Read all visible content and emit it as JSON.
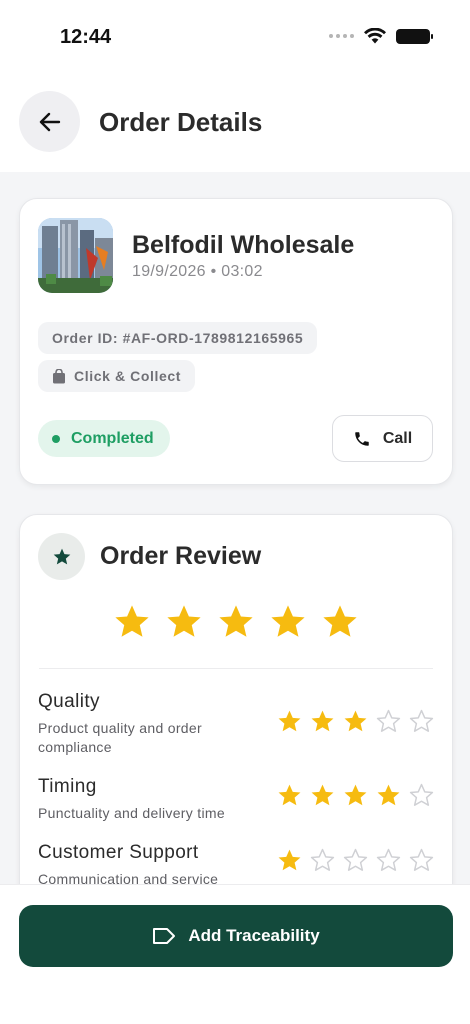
{
  "status_bar": {
    "time": "12:44"
  },
  "header": {
    "title": "Order Details"
  },
  "order": {
    "store_name": "Belfodil Wholesale",
    "datetime": "19/9/2026 • 03:02",
    "order_id": "Order ID: #AF-ORD-1789812165965",
    "fulfillment": "Click & Collect",
    "status": "Completed",
    "call_label": "Call"
  },
  "review": {
    "title": "Order Review",
    "overall_rating": 5,
    "ratings": [
      {
        "label": "Quality",
        "description": "Product quality and order compliance",
        "stars": 3
      },
      {
        "label": "Timing",
        "description": "Punctuality and delivery time",
        "stars": 4
      },
      {
        "label": "Customer Support",
        "description": "Communication and service",
        "stars": 1
      }
    ]
  },
  "footer": {
    "button_label": "Add Traceability"
  },
  "colors": {
    "accent": "#134a3c",
    "star": "#f6bb10",
    "star_empty": "#cfd0d4",
    "success": "#1e9e63"
  },
  "icons": {
    "back": "arrow-left-icon",
    "bag": "shopping-bag-icon",
    "phone": "phone-icon",
    "review": "star-icon",
    "tag": "tag-icon"
  }
}
